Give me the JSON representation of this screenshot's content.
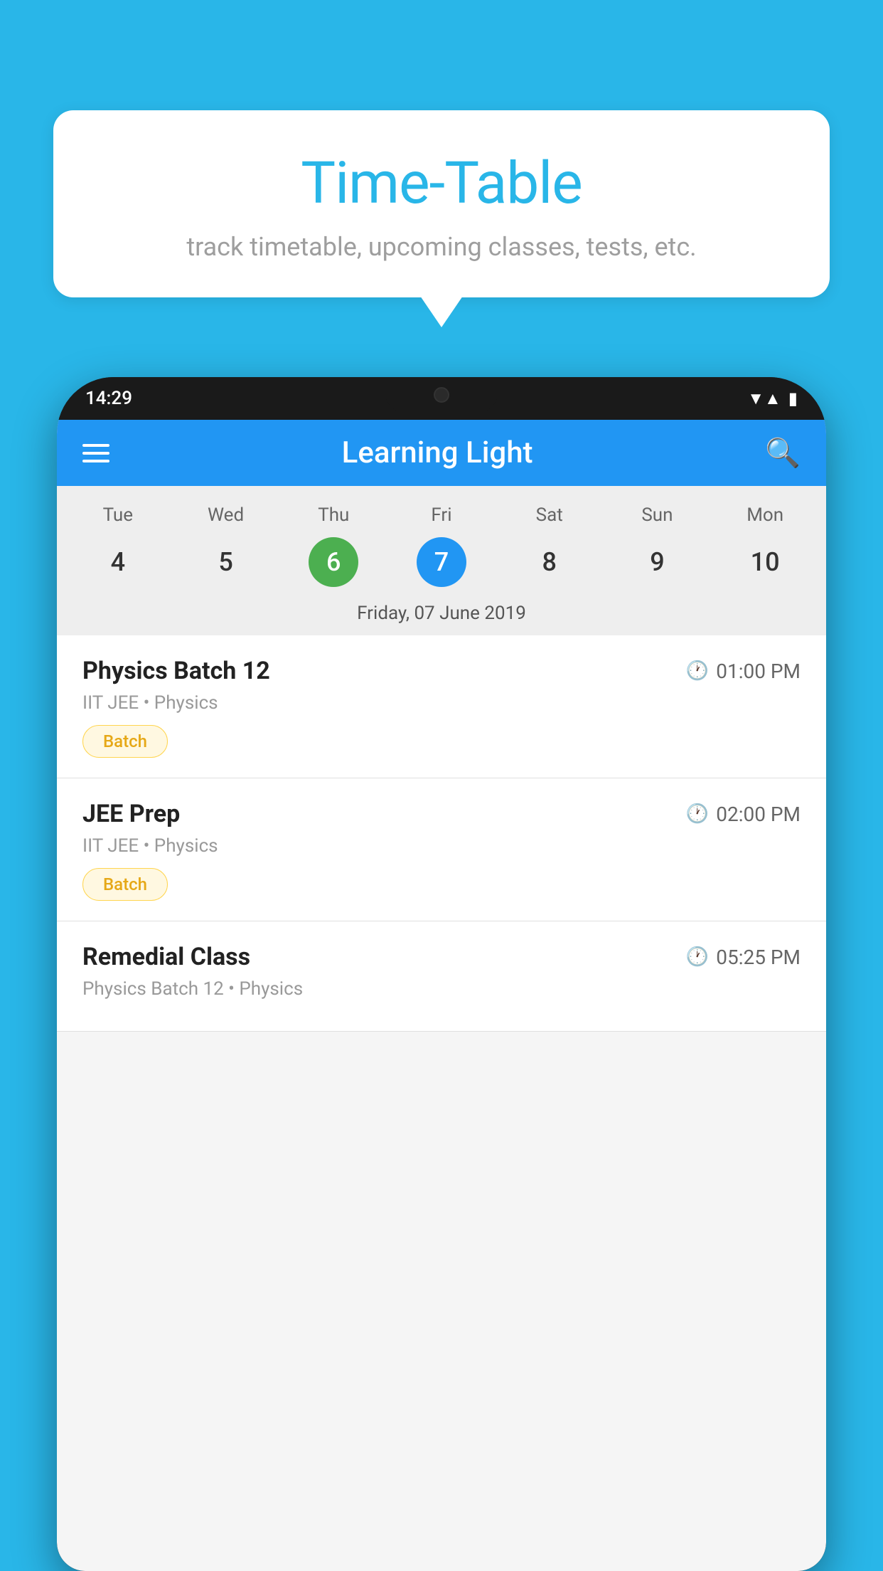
{
  "background": {
    "color": "#29b6e8"
  },
  "speech_bubble": {
    "title": "Time-Table",
    "subtitle": "track timetable, upcoming classes, tests, etc."
  },
  "phone": {
    "status_bar": {
      "time": "14:29",
      "wifi": "▼▲",
      "battery": "▮"
    },
    "app_header": {
      "title": "Learning Light",
      "hamburger_label": "menu",
      "search_label": "search"
    },
    "calendar": {
      "days": [
        "Tue",
        "Wed",
        "Thu",
        "Fri",
        "Sat",
        "Sun",
        "Mon"
      ],
      "dates": [
        "4",
        "5",
        "6",
        "7",
        "8",
        "9",
        "10"
      ],
      "today_index": 2,
      "selected_index": 3,
      "selected_label": "Friday, 07 June 2019"
    },
    "classes": [
      {
        "name": "Physics Batch 12",
        "time": "01:00 PM",
        "meta": "IIT JEE • Physics",
        "tag": "Batch"
      },
      {
        "name": "JEE Prep",
        "time": "02:00 PM",
        "meta": "IIT JEE • Physics",
        "tag": "Batch"
      },
      {
        "name": "Remedial Class",
        "time": "05:25 PM",
        "meta": "Physics Batch 12 • Physics",
        "tag": ""
      }
    ]
  }
}
